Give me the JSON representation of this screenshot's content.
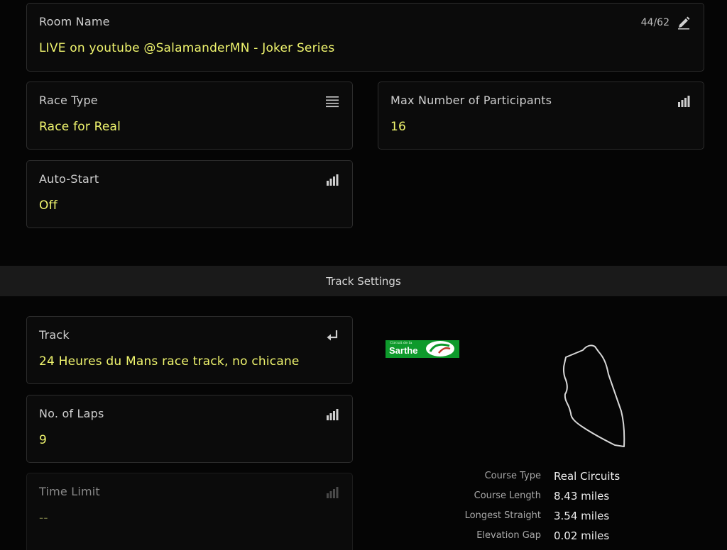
{
  "room": {
    "label": "Room Name",
    "value": "LIVE on youtube @SalamanderMN - Joker Series",
    "counter": "44/62",
    "icon": "pencil-icon"
  },
  "race_type": {
    "label": "Race Type",
    "value": "Race for Real",
    "icon": "list-icon"
  },
  "max_participants": {
    "label": "Max Number of Participants",
    "value": "16",
    "icon": "signal-bars-icon"
  },
  "auto_start": {
    "label": "Auto-Start",
    "value": "Off",
    "icon": "signal-bars-icon"
  },
  "section": {
    "title": "Track Settings"
  },
  "track": {
    "label": "Track",
    "value": "24 Heures du Mans race track, no chicane",
    "icon": "return-arrow-icon"
  },
  "laps": {
    "label": "No. of Laps",
    "value": "9",
    "icon": "signal-bars-icon"
  },
  "time_limit": {
    "label": "Time Limit",
    "value": "--",
    "icon": "signal-bars-icon"
  },
  "logo": {
    "small_text": "Circuit de la",
    "main_text": "Sarthe"
  },
  "stats": [
    {
      "key": "Course Type",
      "value": "Real Circuits"
    },
    {
      "key": "Course Length",
      "value": "8.43 miles"
    },
    {
      "key": "Longest Straight",
      "value": "3.54 miles"
    },
    {
      "key": "Elevation Gap",
      "value": "0.02 miles"
    }
  ],
  "colors": {
    "accent": "#f0f56e",
    "background": "#050505",
    "card": "#0b0b0b",
    "logo_green": "#0e9a2c"
  }
}
